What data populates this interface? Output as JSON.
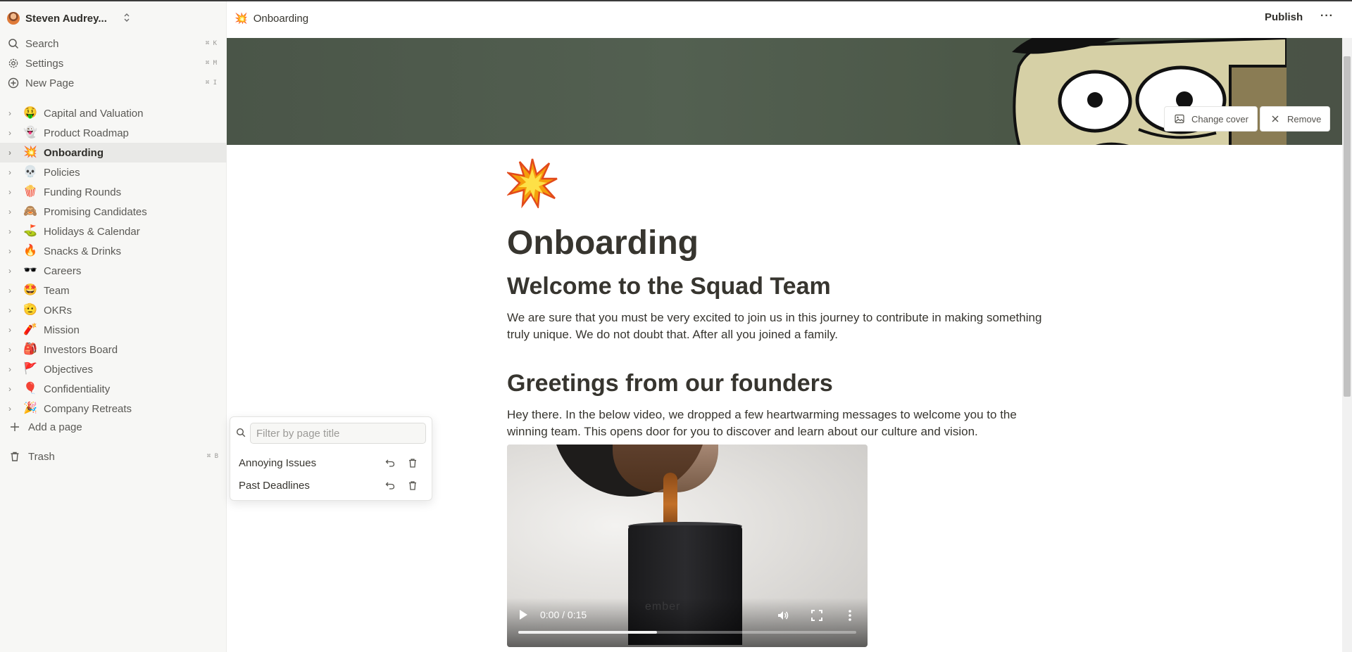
{
  "workspace": {
    "name": "Steven Audrey..."
  },
  "nav": {
    "search": {
      "label": "Search",
      "shortcut": "⌘ K",
      "icon": "search-icon"
    },
    "settings": {
      "label": "Settings",
      "shortcut": "⌘ M",
      "icon": "gear-icon"
    },
    "new_page": {
      "label": "New Page",
      "shortcut": "⌘ I",
      "icon": "plus-circle-icon"
    }
  },
  "pages": [
    {
      "emoji": "🤑",
      "label": "Capital and Valuation"
    },
    {
      "emoji": "👻",
      "label": "Product Roadmap"
    },
    {
      "emoji": "💥",
      "label": "Onboarding",
      "active": true
    },
    {
      "emoji": "💀",
      "label": "Policies"
    },
    {
      "emoji": "🍿",
      "label": "Funding Rounds"
    },
    {
      "emoji": "🙈",
      "label": "Promising Candidates"
    },
    {
      "emoji": "⛳",
      "label": "Holidays & Calendar"
    },
    {
      "emoji": "🔥",
      "label": "Snacks & Drinks"
    },
    {
      "emoji": "🕶️",
      "label": "Careers"
    },
    {
      "emoji": "🤩",
      "label": "Team"
    },
    {
      "emoji": "🫡",
      "label": "OKRs"
    },
    {
      "emoji": "🧨",
      "label": "Mission"
    },
    {
      "emoji": "🎒",
      "label": "Investors Board"
    },
    {
      "emoji": "🚩",
      "label": "Objectives"
    },
    {
      "emoji": "🎈",
      "label": "Confidentiality"
    },
    {
      "emoji": "🎉",
      "label": "Company Retreats"
    }
  ],
  "sidebar": {
    "add_page": "Add a page",
    "trash": {
      "label": "Trash",
      "shortcut": "⌘ B"
    }
  },
  "topbar": {
    "crumb_emoji": "💥",
    "crumb_title": "Onboarding",
    "publish": "Publish",
    "more": "···"
  },
  "cover": {
    "change": "Change cover",
    "remove": "Remove"
  },
  "doc": {
    "emoji": "💥",
    "title": "Onboarding",
    "h1_welcome": "Welcome to the Squad Team",
    "p_welcome": "We are sure that you must be very excited to join us in this journey to contribute in making something truly unique. We do not doubt that. After all you joined a family.",
    "h1_greetings": "Greetings from our founders",
    "p_greetings": "Hey there. In the below video, we dropped a few heartwarming messages to welcome you to the winning team. This opens door for you to discover and learn about our culture and vision."
  },
  "video": {
    "time": "0:00 / 0:15",
    "progress": 0.41,
    "brand": "ember"
  },
  "trash_popover": {
    "placeholder": "Filter by page title",
    "items": [
      {
        "label": "Annoying Issues"
      },
      {
        "label": "Past Deadlines"
      }
    ]
  },
  "colors": {
    "sidebar_bg": "#f7f7f5",
    "active_bg": "#e9e9e7",
    "text": "#37352f"
  }
}
